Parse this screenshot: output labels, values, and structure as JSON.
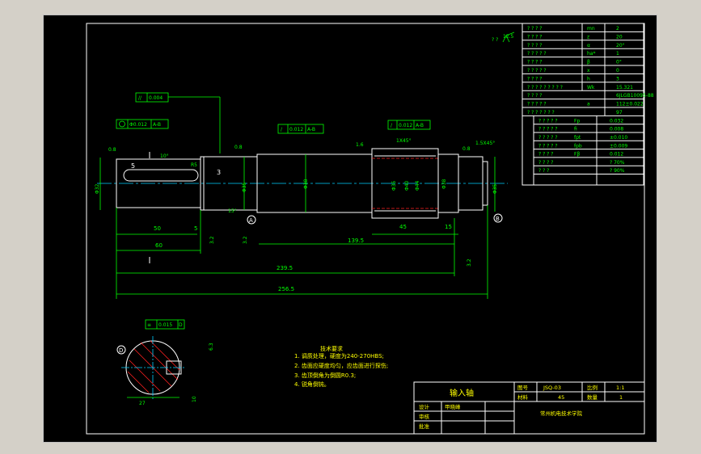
{
  "param_table": [
    {
      "name": "? ? ? ?",
      "sym": "mn",
      "val": "2"
    },
    {
      "name": "? ? ? ?",
      "sym": "z",
      "val": "20"
    },
    {
      "name": "? ? ? ?",
      "sym": "α",
      "val": "20°"
    },
    {
      "name": "? ? ? ? ?",
      "sym": "ha*",
      "val": "1"
    },
    {
      "name": "? ? ? ?",
      "sym": "β",
      "val": "0°"
    },
    {
      "name": "? ? ? ? ?",
      "sym": "x",
      "val": "0"
    },
    {
      "name": "? ? ? ?",
      "sym": "h",
      "val": "3"
    },
    {
      "name": "? ? ? ? ? ? ? ? ?",
      "sym": "Wk",
      "val": "15.321"
    },
    {
      "name": "? ? ? ?",
      "sym": "",
      "val": "6JLGB10095-88"
    },
    {
      "name": "? ? ? ? ?",
      "sym": "a",
      "val": "112±0.022"
    },
    {
      "name": "? ? ? ? ? ? ?",
      "sym": "",
      "val": "97"
    }
  ],
  "tol_table": [
    {
      "name": "? ? ? ? ?",
      "sym": "Fp",
      "val": "0.032"
    },
    {
      "name": "? ? ? ? ?",
      "sym": "fi",
      "val": "0.008"
    },
    {
      "name": "? ? ? ? ?",
      "sym": "fpt",
      "val": "±0.010"
    },
    {
      "name": "? ? ? ? ?",
      "sym": "fpb",
      "val": "±0.009"
    },
    {
      "name": "? ? ? ?",
      "sym": "Fβ",
      "val": "0.012"
    },
    {
      "name": "? ? ? ?",
      "sym": "",
      "val": "? 70%"
    },
    {
      "name": "? ? ?",
      "sym": "",
      "val": "? 90%"
    }
  ],
  "dims": {
    "gdt_run": "0.004",
    "gdt_coax": "Φ0.012",
    "gdt_datum_ab": "A-B",
    "gdt_perp1": "0.012",
    "gdt_perp2": "0.012",
    "d32": "Φ32",
    "d35a": "Φ35",
    "d38": "Φ38",
    "d35b": "Φ35",
    "d40": "Φ40",
    "d44": "Φ44",
    "d38b": "Φ38",
    "d35c": "Φ35",
    "len50": "50",
    "len60": "60",
    "len5": "5",
    "len5b": "5",
    "len3": "3",
    "len45": "45",
    "len15": "15",
    "len139": "139.5",
    "len239": "239.5",
    "len256": "256.5",
    "chamfer1": "1X45°",
    "chamfer2": "1.5X45°",
    "r5": "R5",
    "ang": "10°",
    "ang15": "15°",
    "ra08a": "0.8",
    "ra08b": "0.8",
    "ra08c": "0.8",
    "ra16": "1.6",
    "ra32": "3.2",
    "ra32b": "3.2",
    "ra32c": "3.2",
    "ra63": "6.3",
    "ra125": "12.5",
    "datum_a": "A",
    "datum_b": "B",
    "datum_d": "D",
    "sym_tol": "0.015",
    "sec_w": "27",
    "sec_d": "10",
    "corner_mark": "? ?"
  },
  "notes": {
    "title": "技术要求",
    "items": [
      "1. 调质处理，硬度为240-270HBS;",
      "2. 齿面应硬度均匀，应齿面进行探伤;",
      "3. 齿顶倒角为倒圆R0.3;",
      "4. 锐角倒钝。"
    ]
  },
  "title_block": {
    "part_name": "输入轴",
    "drawing_no_label": "图号",
    "drawing_no": "JSQ-03",
    "scale_label": "比例",
    "scale": "1:1",
    "material_label": "材料",
    "material": "45",
    "qty_label": "数量",
    "qty": "1",
    "design_label": "设计",
    "designer": "甲晓峰",
    "check_label": "审核",
    "approve_label": "批准",
    "school": "常州机电技术学院"
  }
}
